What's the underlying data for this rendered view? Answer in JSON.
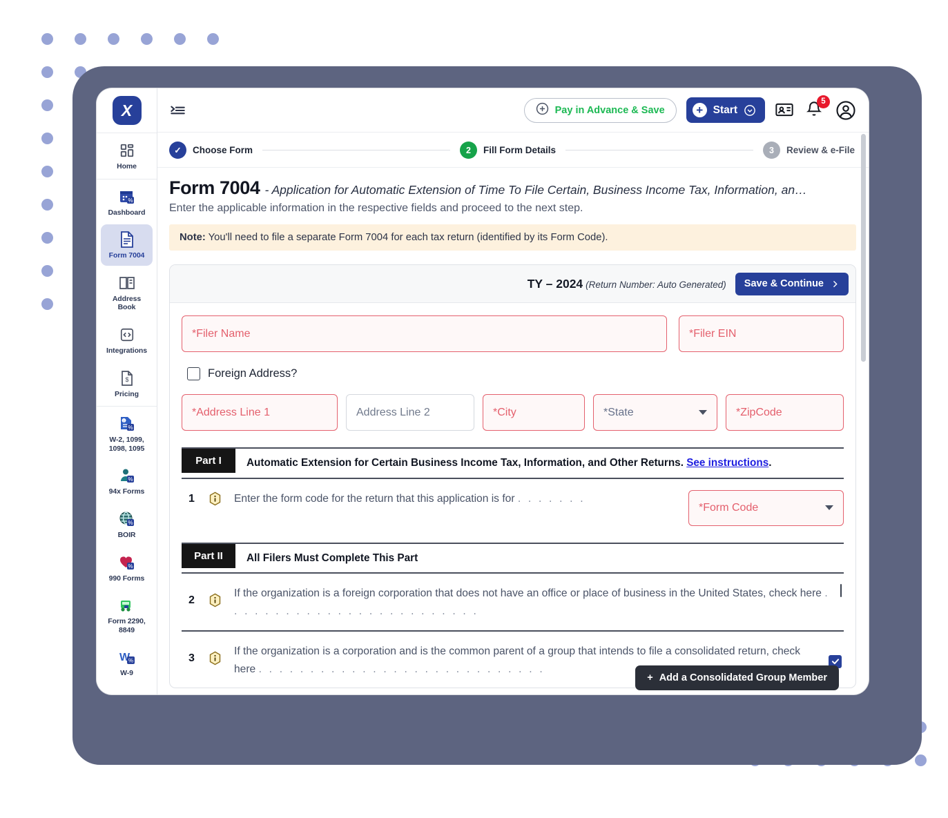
{
  "brand": {
    "logo_text": "X",
    "logo_color": "#27409a"
  },
  "topbar": {
    "menu_icon": "indent-menu-icon",
    "pay_advance_label": "Pay in Advance & Save",
    "pay_advance_color": "#1db954",
    "start_label": "Start",
    "card_icon": "contact-card-icon",
    "bell_icon": "bell-icon",
    "bell_badge": "5",
    "avatar_icon": "user-avatar-icon"
  },
  "sidebar": {
    "items": [
      {
        "label": "Home",
        "icon": "grid-icon",
        "active": false
      },
      {
        "label": "Dashboard",
        "icon": "calendar-tax-icon",
        "active": false
      },
      {
        "label": "Form 7004",
        "icon": "document-icon",
        "active": true
      },
      {
        "label": "Address Book",
        "icon": "address-book-icon",
        "active": false
      },
      {
        "label": "Integrations",
        "icon": "code-brackets-icon",
        "active": false
      },
      {
        "label": "Pricing",
        "icon": "price-tag-icon",
        "active": false
      },
      {
        "label": "W-2, 1099, 1098, 1095",
        "icon": "forms-stack-icon",
        "active": false
      },
      {
        "label": "94x Forms",
        "icon": "person-tax-icon",
        "active": false
      },
      {
        "label": "BOIR",
        "icon": "globe-icon",
        "active": false
      },
      {
        "label": "990 Forms",
        "icon": "heart-icon",
        "active": false
      },
      {
        "label": "Form 2290, 8849",
        "icon": "truck-icon",
        "active": false
      },
      {
        "label": "W-9",
        "icon": "w-letter-icon",
        "active": false
      }
    ]
  },
  "stepper": {
    "steps": [
      {
        "num": "✓",
        "label": "Choose Form",
        "state": "done"
      },
      {
        "num": "2",
        "label": "Fill Form Details",
        "state": "current"
      },
      {
        "num": "3",
        "label": "Review & e-File",
        "state": "todo"
      }
    ]
  },
  "page": {
    "title": "Form 7004",
    "title_sub": "- Application for Automatic Extension of Time To File Certain, Business Income Tax, Information, an…",
    "subtitle": "Enter the applicable information in the respective fields and proceed to the next step.",
    "note_label": "Note:",
    "note_text": " You'll need to file a separate Form 7004 for each tax return (identified by its Form Code)."
  },
  "card": {
    "ty_label": "TY – 2024",
    "return_number": "(Return Number: Auto Generated)",
    "save_label": "Save & Continue"
  },
  "form": {
    "filer_name_placeholder": "*Filer Name",
    "filer_name_value": "",
    "filer_ein_placeholder": "*Filer EIN",
    "filer_ein_value": "",
    "foreign_address_label": "Foreign Address?",
    "foreign_address_checked": false,
    "address1_placeholder": "*Address Line 1",
    "address1_value": "",
    "address2_placeholder": "Address Line 2",
    "address2_value": "",
    "city_placeholder": "*City",
    "city_value": "",
    "state_placeholder": "*State",
    "state_value": "",
    "zip_placeholder": "*ZipCode",
    "zip_value": ""
  },
  "part1": {
    "tag": "Part I",
    "heading": "Automatic Extension for Certain Business Income Tax, Information, and Other Returns. ",
    "link": "See instructions",
    "heading_end": ".",
    "q1_num": "1",
    "q1_text": "Enter the form code for the return that this application is for",
    "q1_dots": ". . . . . . .",
    "form_code_placeholder": "*Form Code",
    "form_code_value": ""
  },
  "part2": {
    "tag": "Part II",
    "heading": "All Filers Must Complete This Part",
    "q2_num": "2",
    "q2_text": "If the organization is a foreign corporation that does not have an office or place of business in the United States, check here",
    "q2_dots": ". . . . . . . . . . . . . . . . . . . . . . . . .",
    "q2_checked": false,
    "q3_num": "3",
    "q3_text": "If the organization is a corporation and is the common parent of a group that intends to file a consolidated return, check here",
    "q3_dots": ". . . . . . . . . . . . . . . . . . . . . . . . . . . .",
    "q3_checked": true,
    "add_member_label": "Add a Consolidated Group Member"
  }
}
